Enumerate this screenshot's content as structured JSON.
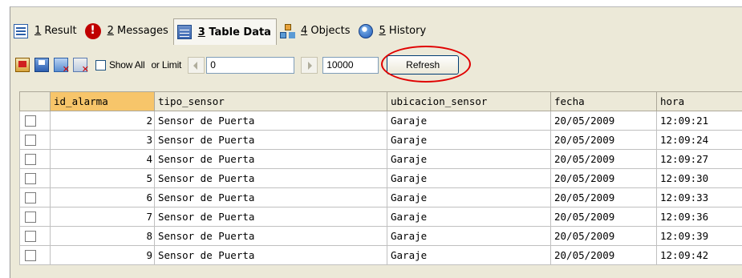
{
  "tabs": [
    {
      "number": "1",
      "rest": " Result",
      "icon": "result-grid-icon"
    },
    {
      "number": "2",
      "rest": " Messages",
      "icon": "error-icon"
    },
    {
      "number": "3",
      "rest": " Table Data",
      "icon": "table-data-icon"
    },
    {
      "number": "4",
      "rest": " Objects",
      "icon": "objects-icon"
    },
    {
      "number": "5",
      "rest": " History",
      "icon": "history-icon"
    }
  ],
  "active_tab": "3 Table Data",
  "toolbar": {
    "show_all_label": "Show All",
    "or_limit_label": "or Limit",
    "offset_value": "0",
    "limit_value": "10000",
    "refresh_label": "Refresh"
  },
  "grid": {
    "columns": [
      "id_alarma",
      "tipo_sensor",
      "ubicacion_sensor",
      "fecha",
      "hora"
    ],
    "selected_column": "id_alarma",
    "rows": [
      {
        "id_alarma": "2",
        "tipo_sensor": "Sensor de Puerta",
        "ubicacion_sensor": "Garaje",
        "fecha": "20/05/2009",
        "hora": "12:09:21"
      },
      {
        "id_alarma": "3",
        "tipo_sensor": "Sensor de Puerta",
        "ubicacion_sensor": "Garaje",
        "fecha": "20/05/2009",
        "hora": "12:09:24"
      },
      {
        "id_alarma": "4",
        "tipo_sensor": "Sensor de Puerta",
        "ubicacion_sensor": "Garaje",
        "fecha": "20/05/2009",
        "hora": "12:09:27"
      },
      {
        "id_alarma": "5",
        "tipo_sensor": "Sensor de Puerta",
        "ubicacion_sensor": "Garaje",
        "fecha": "20/05/2009",
        "hora": "12:09:30"
      },
      {
        "id_alarma": "6",
        "tipo_sensor": "Sensor de Puerta",
        "ubicacion_sensor": "Garaje",
        "fecha": "20/05/2009",
        "hora": "12:09:33"
      },
      {
        "id_alarma": "7",
        "tipo_sensor": "Sensor de Puerta",
        "ubicacion_sensor": "Garaje",
        "fecha": "20/05/2009",
        "hora": "12:09:36"
      },
      {
        "id_alarma": "8",
        "tipo_sensor": "Sensor de Puerta",
        "ubicacion_sensor": "Garaje",
        "fecha": "20/05/2009",
        "hora": "12:09:39"
      },
      {
        "id_alarma": "9",
        "tipo_sensor": "Sensor de Puerta",
        "ubicacion_sensor": "Garaje",
        "fecha": "20/05/2009",
        "hora": "12:09:42"
      }
    ]
  },
  "colors": {
    "selected_header": "#f7c56a",
    "highlight_ellipse": "#e00000"
  }
}
